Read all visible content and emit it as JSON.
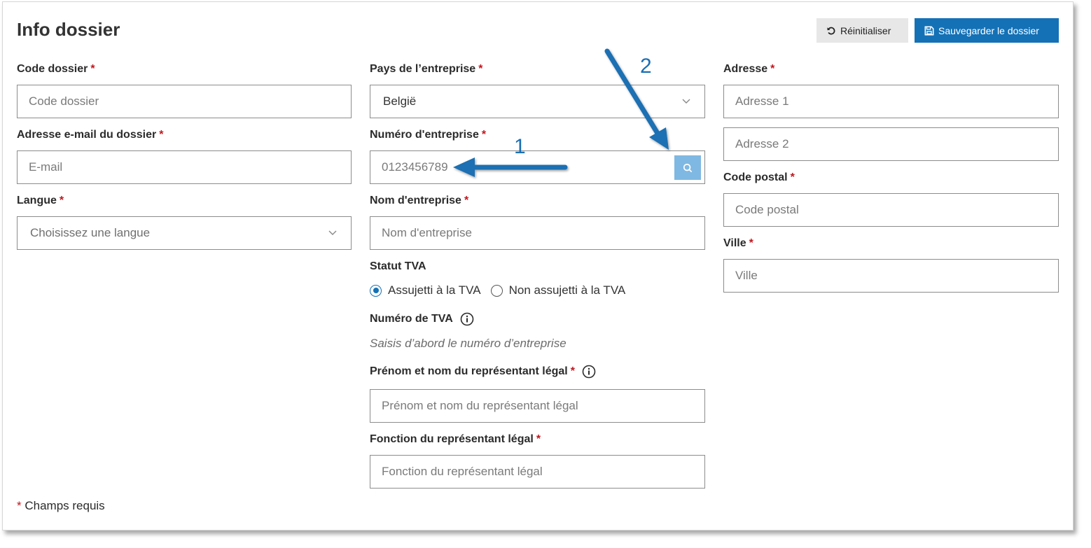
{
  "header": {
    "title": "Info dossier",
    "reset_label": "Réinitialiser",
    "save_label": "Sauvegarder le dossier"
  },
  "required_mark": "*",
  "col1": {
    "code": {
      "label": "Code dossier",
      "placeholder": "Code dossier"
    },
    "email": {
      "label": "Adresse e-mail du dossier",
      "placeholder": "E-mail"
    },
    "language": {
      "label": "Langue",
      "placeholder": "Choisissez une langue"
    }
  },
  "col2": {
    "country": {
      "label": "Pays de l’entreprise",
      "value": "België"
    },
    "company_number": {
      "label": "Numéro d'entreprise",
      "placeholder": "0123456789"
    },
    "company_name": {
      "label": "Nom d'entreprise",
      "placeholder": "Nom d'entreprise"
    },
    "vat_status": {
      "label": "Statut TVA",
      "options": [
        "Assujetti à la TVA",
        "Non assujetti à la TVA"
      ],
      "selected": "Assujetti à la TVA"
    },
    "vat_number": {
      "label": "Numéro de TVA",
      "hint": "Saisis d’abord le numéro d’entreprise"
    },
    "rep_name": {
      "label": "Prénom et nom du représentant légal",
      "placeholder": "Prénom et nom du représentant légal"
    },
    "rep_function": {
      "label": "Fonction du représentant légal",
      "placeholder": "Fonction du représentant légal"
    }
  },
  "col3": {
    "address": {
      "label": "Adresse",
      "placeholder1": "Adresse 1",
      "placeholder2": "Adresse 2"
    },
    "postal": {
      "label": "Code postal",
      "placeholder": "Code postal"
    },
    "city": {
      "label": "Ville",
      "placeholder": "Ville"
    }
  },
  "footnote": {
    "text": "Champs requis"
  },
  "annotations": {
    "arrow1_label": "1",
    "arrow2_label": "2",
    "arrow_color": "#1a6fb3"
  },
  "colors": {
    "primary": "#1471b6",
    "required": "#c0171e",
    "search_button": "#7fb8e2"
  }
}
